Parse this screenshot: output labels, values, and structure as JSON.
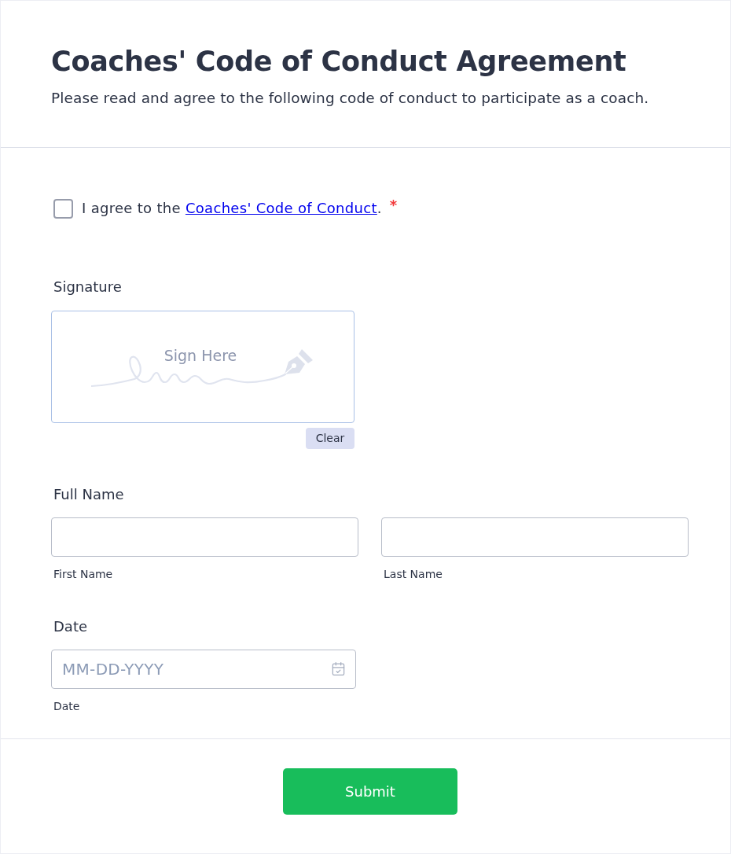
{
  "header": {
    "title": "Coaches' Code of Conduct Agreement",
    "subtitle": "Please read and agree to the following code of conduct to participate as a coach."
  },
  "agreement": {
    "checked": false,
    "text_before": "I agree to the ",
    "link": "Coaches' Code of Conduct",
    "text_after": ".",
    "required_mark": "*"
  },
  "signature": {
    "label": "Signature",
    "placeholder": "Sign Here",
    "clear_button": "Clear"
  },
  "full_name": {
    "label": "Full Name",
    "fields": [
      {
        "sublabel": "First Name"
      },
      {
        "sublabel": "Last Name"
      }
    ]
  },
  "date": {
    "label": "Date",
    "placeholder": "MM-DD-YYYY",
    "sublabel": "Date"
  },
  "submit": {
    "label": "Submit"
  }
}
